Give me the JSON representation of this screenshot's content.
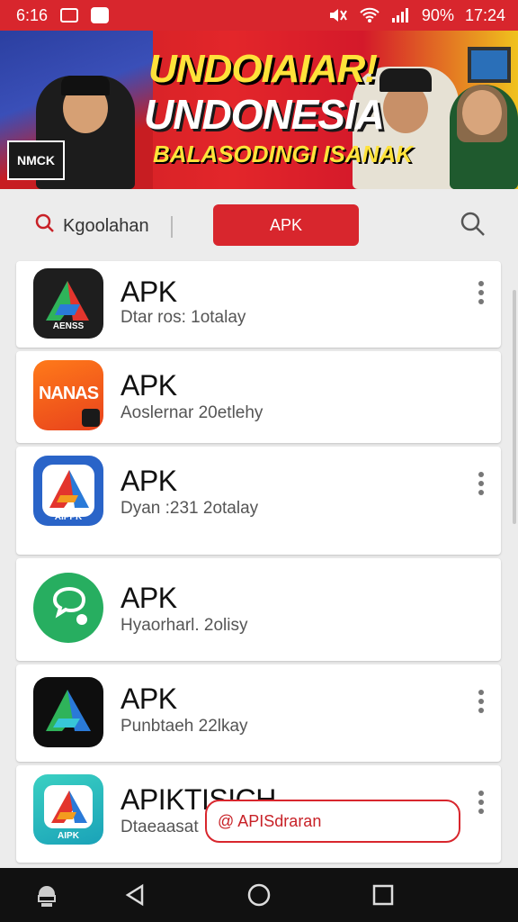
{
  "status_bar": {
    "left_time": "6:16",
    "battery_text": "90%",
    "time": "17:24",
    "icons": [
      "wifi-icon",
      "signal-icon",
      "mute-icon"
    ]
  },
  "banner": {
    "line1": "UNDOIAIAR!",
    "line2": "UNDONESIA",
    "line3": "BALASODINGI ISANAK",
    "badge": "NMCK"
  },
  "tabs": {
    "search_label": "Kgoolahan",
    "active_label": "APK"
  },
  "apps": [
    {
      "name": "APK",
      "subtitle": "Dtar ros: 1otalay",
      "icon_text": "AENSS",
      "has_menu": true
    },
    {
      "name": "APK",
      "subtitle": "Aoslernar 20etlehy",
      "icon_text": "NANAS",
      "has_menu": false
    },
    {
      "name": "APK",
      "subtitle": "Dyan :231 2otalay",
      "icon_text": "AIPPK",
      "has_menu": true
    },
    {
      "name": "APK",
      "subtitle": "Hyaorharl. 2olisy",
      "icon_text": "",
      "has_menu": false
    },
    {
      "name": "APK",
      "subtitle": "Punbtaeh 22lkay",
      "icon_text": "",
      "has_menu": true
    },
    {
      "name": "APIKTISICH",
      "subtitle": "Dtaeaasat",
      "icon_text": "AIPK",
      "has_menu": true
    }
  ],
  "toast": {
    "text": "@ APISdraran"
  },
  "colors": {
    "accent": "#d8262d",
    "nav": "#111111",
    "background": "#ececec"
  }
}
